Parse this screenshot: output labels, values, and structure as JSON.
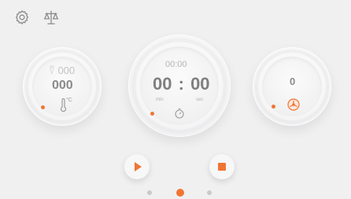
{
  "colors": {
    "accent": "#f07533",
    "text": "#9b9b9b",
    "background": "#f0f0f1"
  },
  "toolbar": {
    "settings_icon": "gear-icon",
    "scale_icon": "balance-scale-icon"
  },
  "left_dial": {
    "tare_value": "000",
    "value": "000",
    "temp_unit": "°C"
  },
  "center_dial": {
    "target_time": "00:00",
    "time_min": "00",
    "separator": ":",
    "time_sec": "00",
    "min_label": "min",
    "sec_label": "sec"
  },
  "right_dial": {
    "value": "0"
  },
  "controls": {
    "play_icon": "play-icon",
    "stop_icon": "stop-icon"
  },
  "pagination": {
    "pages": 3,
    "active": 1
  }
}
